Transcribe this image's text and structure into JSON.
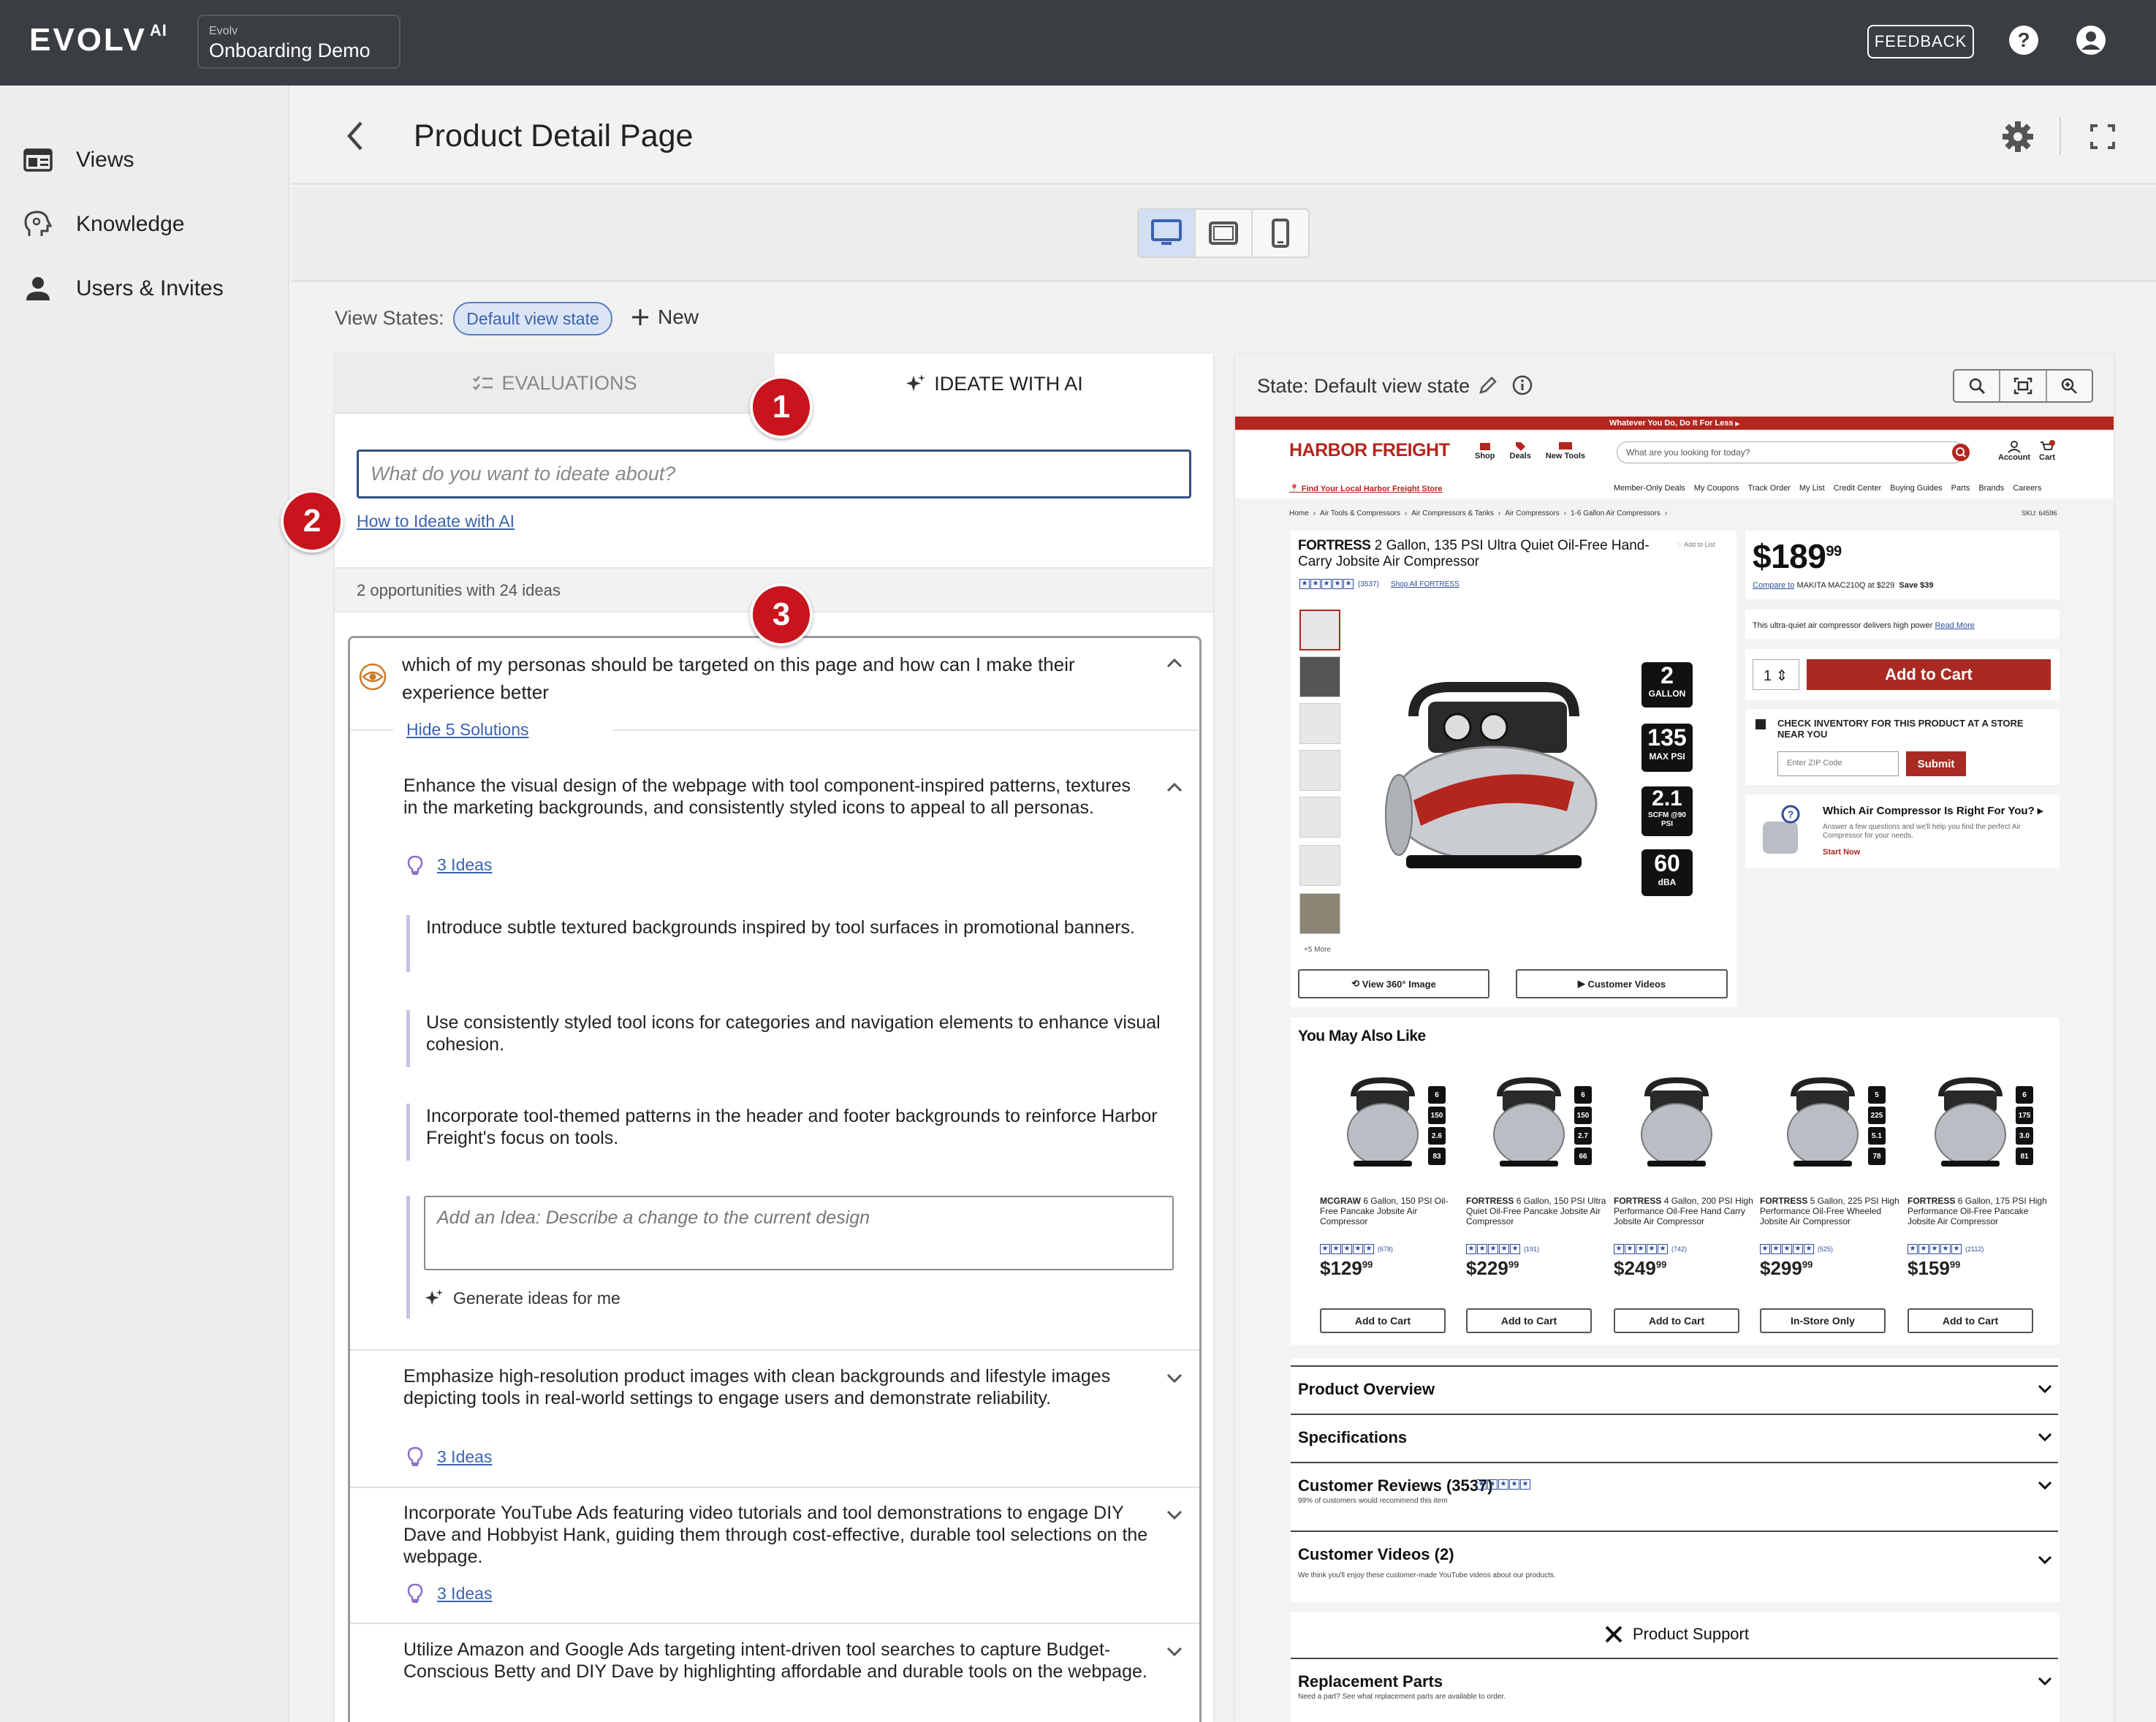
{
  "app": {
    "logo": "EVOLV",
    "logo_sup": "AI",
    "workspace_small": "Evolv",
    "workspace_name": "Onboarding Demo",
    "feedback": "FEEDBACK"
  },
  "sidebar": {
    "items": [
      {
        "label": "Views",
        "icon": "views-icon"
      },
      {
        "label": "Knowledge",
        "icon": "knowledge-icon"
      },
      {
        "label": "Users & Invites",
        "icon": "user-icon"
      }
    ]
  },
  "header": {
    "title": "Product Detail Page"
  },
  "view_states": {
    "label": "View States:",
    "chip": "Default view state",
    "new": "New"
  },
  "tabs": {
    "evaluations": "EVALUATIONS",
    "ideate": "IDEATE WITH AI"
  },
  "ideate": {
    "placeholder": "What do you want to ideate about?",
    "howto": "How to Ideate with AI",
    "count": "2 opportunities with 24 ideas"
  },
  "badges": [
    "1",
    "2",
    "3"
  ],
  "opportunity": {
    "question": "which of my personas should be targeted on this page and how can I make their experience better",
    "hide_link": "Hide 5 Solutions",
    "solutions": [
      {
        "text": "Enhance the visual design of the webpage with tool component-inspired patterns, textures in the marketing backgrounds, and consistently styled icons to appeal to all personas.",
        "ideas_link": "3 Ideas"
      },
      {
        "text": "Emphasize high-resolution product images with clean backgrounds and lifestyle images depicting tools in real-world settings to engage users and demonstrate reliability.",
        "ideas_link": "3 Ideas"
      },
      {
        "text": "Incorporate YouTube Ads featuring video tutorials and tool demonstrations to engage DIY Dave and Hobbyist Hank, guiding them through cost-effective, durable tool selections on the webpage.",
        "ideas_link": "3 Ideas"
      },
      {
        "text": "Utilize Amazon and Google Ads targeting intent-driven tool searches to capture Budget-Conscious Betty and DIY Dave by highlighting affordable and durable tools on the webpage."
      }
    ],
    "ideas": [
      "Introduce subtle textured backgrounds inspired by tool surfaces in promotional banners.",
      "Use consistently styled tool icons for categories and navigation elements to enhance visual cohesion.",
      "Incorporate tool-themed patterns in the header and footer backgrounds to reinforce Harbor Freight's focus on tools."
    ],
    "add_idea_placeholder": "Add an Idea: Describe a change to the current design",
    "generate": "Generate ideas for me"
  },
  "preview": {
    "state_label": "State: Default view state",
    "promo": "Whatever You Do, Do It For Less",
    "brand": "HARBOR FREIGHT",
    "nav": [
      "Shop",
      "Deals",
      "New Tools"
    ],
    "search_placeholder": "What are you looking for today?",
    "account": "Account",
    "cart": "Cart",
    "find_store": "Find Your Local Harbor Freight Store",
    "links": [
      "Member-Only Deals",
      "My Coupons",
      "Track Order",
      "My List",
      "Credit Center",
      "Buying Guides",
      "Parts",
      "Brands",
      "Careers"
    ],
    "breadcrumb": [
      "Home",
      "Air Tools & Compressors",
      "Air Compressors & Tanks",
      "Air Compressors",
      "1-6 Gallon Air Compressors"
    ],
    "sku": "SKU: 64596",
    "product_brand": "FORTRESS",
    "product_title": "2 Gallon, 135 PSI Ultra Quiet Oil-Free Hand-Carry Jobsite Air Compressor",
    "add_to_list": "Add to List",
    "reviews": "(3537)",
    "shop_all": "Shop All FORTRESS",
    "more_images": "+5 More",
    "specs": [
      {
        "value": "2",
        "unit": "GALLON"
      },
      {
        "value": "135",
        "unit": "MAX PSI"
      },
      {
        "value": "2.1",
        "unit": "SCFM @90 PSI"
      },
      {
        "value": "60",
        "unit": "dBA"
      }
    ],
    "view360": "View 360° Image",
    "videos": "Customer Videos",
    "price_dollars": "$189",
    "price_cents": "99",
    "compare": "Compare to",
    "compare_detail": "MAKITA MAC210Q at $229",
    "save": "Save $39",
    "short_desc": "This ultra-quiet air compressor delivers high power",
    "read_more": "Read More",
    "qty": "1",
    "add_to_cart": "Add to Cart",
    "inventory_title": "CHECK INVENTORY FOR THIS PRODUCT AT A STORE NEAR YOU",
    "zip_placeholder": "Enter ZIP Code",
    "submit": "Submit",
    "quiz_title": "Which Air Compressor Is Right For You?",
    "quiz_sub": "Answer a few questions and we'll help you find the perfect Air Compressor for your needs.",
    "quiz_cta": "Start Now",
    "ymal_title": "You May Also Like",
    "recs": [
      {
        "brand": "MCGRAW",
        "name": "6 Gallon, 150 PSI Oil-Free Pancake Jobsite Air Compressor",
        "reviews": "(678)",
        "price": "$129",
        "cents": "99",
        "btn": "Add to Cart",
        "specs": [
          "6",
          "150",
          "2.6",
          "83"
        ]
      },
      {
        "brand": "FORTRESS",
        "name": "6 Gallon, 150 PSI Ultra Quiet Oil-Free Pancake Jobsite Air Compressor",
        "reviews": "(191)",
        "price": "$229",
        "cents": "99",
        "btn": "Add to Cart",
        "specs": [
          "6",
          "150",
          "2.7",
          "66"
        ]
      },
      {
        "brand": "FORTRESS",
        "name": "4 Gallon, 200 PSI High Performance Oil-Free Hand Carry Jobsite Air Compressor",
        "reviews": "(742)",
        "price": "$249",
        "cents": "99",
        "btn": "Add to Cart",
        "specs": []
      },
      {
        "brand": "FORTRESS",
        "name": "5 Gallon, 225 PSI High Performance Oil-Free Wheeled Jobsite Air Compressor",
        "reviews": "(525)",
        "price": "$299",
        "cents": "99",
        "btn": "In-Store Only",
        "specs": [
          "5",
          "225",
          "5.1",
          "78"
        ]
      },
      {
        "brand": "FORTRESS",
        "name": "6 Gallon, 175 PSI High Performance Oil-Free Pancake Jobsite Air Compressor",
        "reviews": "(2112)",
        "price": "$159",
        "cents": "99",
        "btn": "Add to Cart",
        "specs": [
          "6",
          "175",
          "3.0",
          "81"
        ]
      }
    ],
    "accordions": [
      {
        "title": "Product Overview"
      },
      {
        "title": "Specifications"
      },
      {
        "title": "Customer Reviews (3537)",
        "sub": "99% of customers would recommend this item"
      },
      {
        "title": "Customer Videos (2)",
        "sub": "We think you'll enjoy these customer-made YouTube videos about our products."
      }
    ],
    "support": "Product Support",
    "replacement": {
      "title": "Replacement Parts",
      "sub": "Need a part? See what replacement parts are available to order."
    }
  },
  "colors": {
    "topbar": "#3a3d41",
    "hf_red": "#b3261e",
    "link_blue": "#3b62b0",
    "badge_red": "#c8141c"
  }
}
